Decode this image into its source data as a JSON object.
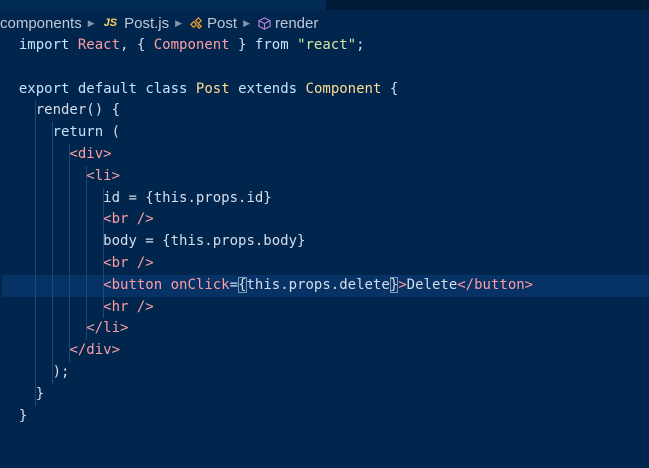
{
  "breadcrumb": {
    "items": [
      {
        "label": "components",
        "icon": ""
      },
      {
        "label": "Post.js",
        "icon": "js-file-icon",
        "badge": "JS"
      },
      {
        "label": "Post",
        "icon": "class-icon"
      },
      {
        "label": "render",
        "icon": "method-cube-icon"
      }
    ]
  },
  "editor": {
    "current_line": 12,
    "colors": {
      "background": "#00264d",
      "current_line": "#073266",
      "keyword": "#c5e4fd",
      "identifier": "#ff9da4",
      "string": "#d6e7a6",
      "plain": "#d6deeb",
      "class": "#ffdd94"
    },
    "lines": [
      {
        "guides": 0,
        "indent": "  ",
        "tokens": [
          [
            "kw",
            "import"
          ],
          [
            "p",
            " "
          ],
          [
            "id",
            "React"
          ],
          [
            "p",
            ", { "
          ],
          [
            "id",
            "Component"
          ],
          [
            "p",
            " } "
          ],
          [
            "kw",
            "from"
          ],
          [
            "p",
            " "
          ],
          [
            "str",
            "\"react\""
          ],
          [
            "p",
            ";"
          ]
        ]
      },
      {
        "guides": 0,
        "indent": "",
        "tokens": []
      },
      {
        "guides": 0,
        "indent": "  ",
        "tokens": [
          [
            "kw",
            "export"
          ],
          [
            "p",
            " "
          ],
          [
            "kw",
            "default"
          ],
          [
            "p",
            " "
          ],
          [
            "kw",
            "class"
          ],
          [
            "p",
            " "
          ],
          [
            "cls",
            "Post"
          ],
          [
            "p",
            " "
          ],
          [
            "kw",
            "extends"
          ],
          [
            "p",
            " "
          ],
          [
            "cls",
            "Component"
          ],
          [
            "p",
            " {"
          ]
        ]
      },
      {
        "guides": 1,
        "indent": "    ",
        "tokens": [
          [
            "p",
            "render() {"
          ]
        ]
      },
      {
        "guides": 2,
        "indent": "      ",
        "tokens": [
          [
            "kw",
            "return"
          ],
          [
            "p",
            " ("
          ]
        ]
      },
      {
        "guides": 3,
        "indent": "        ",
        "tokens": [
          [
            "tag",
            "<div>"
          ]
        ]
      },
      {
        "guides": 4,
        "indent": "          ",
        "tokens": [
          [
            "tag",
            "<li>"
          ]
        ]
      },
      {
        "guides": 5,
        "indent": "            ",
        "tokens": [
          [
            "p",
            "id = {this.props.id}"
          ]
        ]
      },
      {
        "guides": 5,
        "indent": "            ",
        "tokens": [
          [
            "tag",
            "<br />"
          ]
        ]
      },
      {
        "guides": 5,
        "indent": "            ",
        "tokens": [
          [
            "p",
            "body = {this.props.body}"
          ]
        ]
      },
      {
        "guides": 5,
        "indent": "            ",
        "tokens": [
          [
            "tag",
            "<br />"
          ]
        ]
      },
      {
        "guides": 5,
        "indent": "            ",
        "tokens": [
          [
            "tag",
            "<button"
          ],
          [
            "p",
            " "
          ],
          [
            "attr",
            "onClick"
          ],
          [
            "p",
            "="
          ],
          [
            "hl",
            "{"
          ],
          [
            "p",
            "this.props.delete"
          ],
          [
            "hl",
            "}"
          ],
          [
            "tag",
            ">"
          ],
          [
            "p",
            "Delete"
          ],
          [
            "tag",
            "</button>"
          ]
        ]
      },
      {
        "guides": 5,
        "indent": "            ",
        "tokens": [
          [
            "tag",
            "<hr />"
          ]
        ]
      },
      {
        "guides": 4,
        "indent": "          ",
        "tokens": [
          [
            "tag",
            "</li>"
          ]
        ]
      },
      {
        "guides": 3,
        "indent": "        ",
        "tokens": [
          [
            "tag",
            "</div>"
          ]
        ]
      },
      {
        "guides": 2,
        "indent": "      ",
        "tokens": [
          [
            "p",
            ");"
          ]
        ]
      },
      {
        "guides": 1,
        "indent": "    ",
        "tokens": [
          [
            "p",
            "}"
          ]
        ]
      },
      {
        "guides": 0,
        "indent": "  ",
        "tokens": [
          [
            "p",
            "}"
          ]
        ]
      }
    ]
  }
}
